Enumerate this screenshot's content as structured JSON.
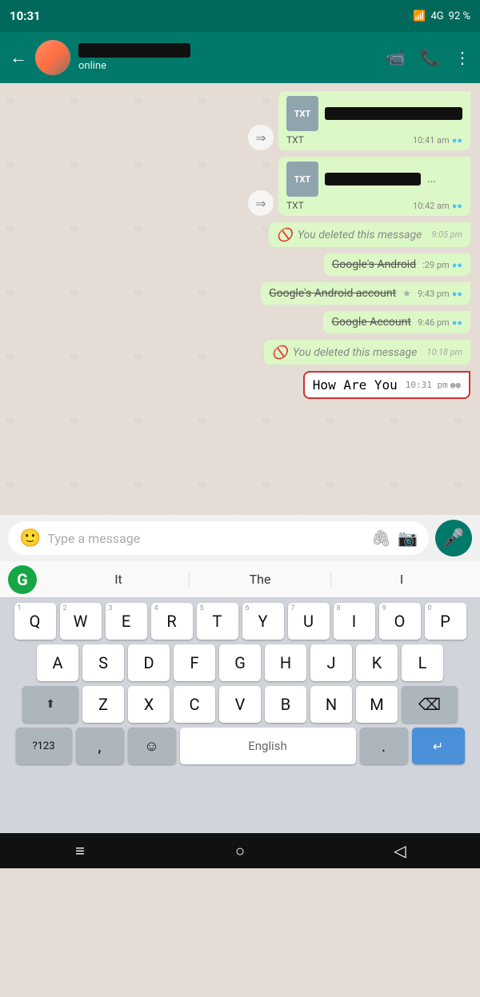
{
  "statusBar": {
    "time": "10:31",
    "signal": "4G",
    "battery": "92 %"
  },
  "header": {
    "contactName": "",
    "status": "online",
    "backLabel": "←",
    "videoIcon": "📹",
    "callIcon": "📞",
    "menuIcon": "⋮"
  },
  "messages": [
    {
      "id": 1,
      "type": "file-sent",
      "fileType": "TXT",
      "fileName": "",
      "label": "TXT",
      "time": "10:41 am",
      "ticks": "●●",
      "ticksColor": "blue",
      "hasForward": true
    },
    {
      "id": 2,
      "type": "file-sent",
      "fileType": "TXT",
      "fileName": "...",
      "label": "TXT",
      "time": "10:42 am",
      "ticks": "●●",
      "ticksColor": "blue",
      "hasForward": true
    },
    {
      "id": 3,
      "type": "deleted-sent",
      "text": "You deleted this message",
      "time": "9:05 pm"
    },
    {
      "id": 4,
      "type": "text-sent-strike",
      "text": "Google's Android",
      "time": ":29 pm",
      "ticks": "●●",
      "ticksColor": "blue"
    },
    {
      "id": 5,
      "type": "text-sent-strike",
      "text": "Google's Android account",
      "time": "9:43 pm",
      "ticks": "●●",
      "ticksColor": "blue",
      "hasstar": true
    },
    {
      "id": 6,
      "type": "text-sent-strike",
      "text": "Google Account",
      "time": "9:46 pm",
      "ticks": "●●",
      "ticksColor": "blue"
    },
    {
      "id": 7,
      "type": "deleted-sent",
      "text": "You deleted this message",
      "time": "10:18 pm"
    },
    {
      "id": 8,
      "type": "text-sent-highlighted",
      "text": "How Are You",
      "time": "10:31 pm",
      "ticks": "●●",
      "ticksColor": "gray"
    }
  ],
  "inputArea": {
    "placeholder": "Type a message",
    "attachIcon": "🖇",
    "cameraIcon": "📷",
    "micIcon": "🎤"
  },
  "suggestions": {
    "grammarly": "G",
    "items": [
      "It",
      "The",
      "I"
    ]
  },
  "keyboard": {
    "row1": [
      {
        "label": "Q",
        "num": "1"
      },
      {
        "label": "W",
        "num": "2"
      },
      {
        "label": "E",
        "num": "3"
      },
      {
        "label": "R",
        "num": "4"
      },
      {
        "label": "T",
        "num": "5"
      },
      {
        "label": "Y",
        "num": "6"
      },
      {
        "label": "U",
        "num": "7"
      },
      {
        "label": "I",
        "num": "8"
      },
      {
        "label": "O",
        "num": "9"
      },
      {
        "label": "P",
        "num": "0"
      }
    ],
    "row2": [
      {
        "label": "A"
      },
      {
        "label": "S"
      },
      {
        "label": "D"
      },
      {
        "label": "F"
      },
      {
        "label": "G"
      },
      {
        "label": "H"
      },
      {
        "label": "J"
      },
      {
        "label": "K"
      },
      {
        "label": "L"
      }
    ],
    "row3": [
      {
        "label": "Z"
      },
      {
        "label": "X"
      },
      {
        "label": "C"
      },
      {
        "label": "V"
      },
      {
        "label": "B"
      },
      {
        "label": "N"
      },
      {
        "label": "M"
      }
    ],
    "row4": {
      "sym": "?123",
      "comma": ",",
      "emoji": "☺",
      "space": "English",
      "dot": ".",
      "enter": "↵"
    }
  },
  "bottomNav": {
    "menu": "≡",
    "home": "○",
    "back": "◁"
  }
}
